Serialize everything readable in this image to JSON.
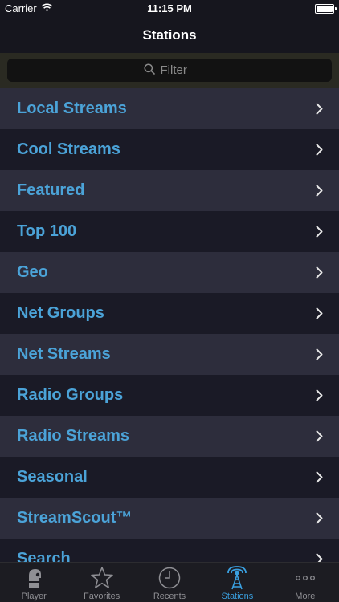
{
  "status_bar": {
    "carrier": "Carrier",
    "time": "11:15 PM",
    "battery_level": 1.0
  },
  "nav": {
    "title": "Stations"
  },
  "search": {
    "placeholder": "Filter"
  },
  "rows": [
    {
      "label": "Local Streams"
    },
    {
      "label": "Cool Streams"
    },
    {
      "label": "Featured"
    },
    {
      "label": "Top 100"
    },
    {
      "label": "Geo"
    },
    {
      "label": "Net Groups"
    },
    {
      "label": "Net Streams"
    },
    {
      "label": "Radio Groups"
    },
    {
      "label": "Radio Streams"
    },
    {
      "label": "Seasonal"
    },
    {
      "label": "StreamScout™"
    },
    {
      "label": "Search"
    }
  ],
  "tabs": [
    {
      "label": "Player",
      "icon": "player-icon"
    },
    {
      "label": "Favorites",
      "icon": "star-icon"
    },
    {
      "label": "Recents",
      "icon": "clock-icon"
    },
    {
      "label": "Stations",
      "icon": "radio-tower-icon",
      "active": true
    },
    {
      "label": "More",
      "icon": "more-icon"
    }
  ],
  "colors": {
    "accent": "#3aa0e0",
    "row_label": "#4ba3d8",
    "row_odd": "#2d2d3c",
    "row_even": "#1a1a26"
  }
}
